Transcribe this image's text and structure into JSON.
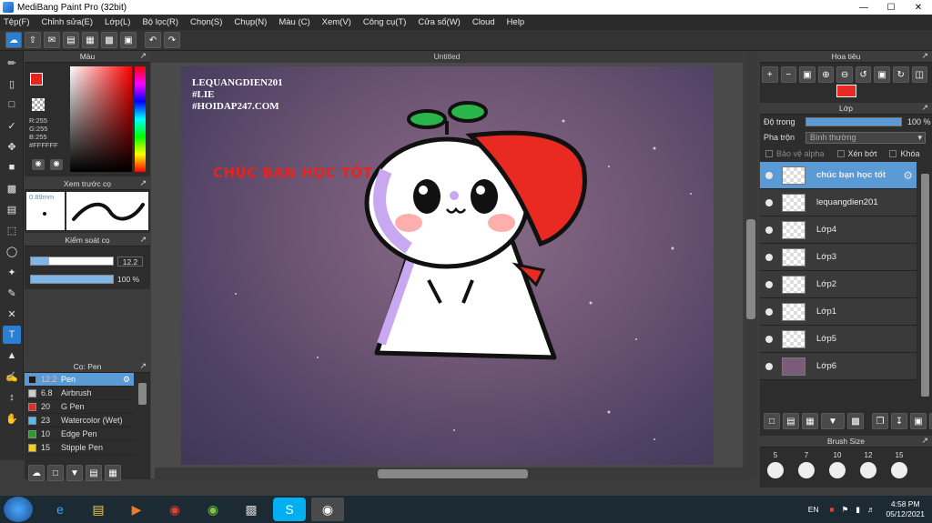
{
  "window": {
    "title": "MediBang Paint Pro (32bit)"
  },
  "menu": [
    "Tệp(F)",
    "Chỉnh sửa(E)",
    "Lớp(L)",
    "Bộ lọc(R)",
    "Chọn(S)",
    "Chụp(N)",
    "Màu (C)",
    "Xem(V)",
    "Công cụ(T)",
    "Cửa sổ(W)",
    "Cloud",
    "Help"
  ],
  "color_panel": {
    "title": "Màu",
    "r": "R:255",
    "g": "G:255",
    "b": "B:255",
    "hex": "#FFFFFF"
  },
  "preview_panel": {
    "title": "Xem trước cọ",
    "size": "0.89mm"
  },
  "brush_control": {
    "title": "Kiểm soát cọ",
    "size": "12.2",
    "opacity": "100 %"
  },
  "brush_panel": {
    "title": "Cọ: Pen",
    "items": [
      {
        "size": "12.2",
        "name": "Pen",
        "color": "#1a1a1a"
      },
      {
        "size": "6.8",
        "name": "Airbrush",
        "color": "#cccccc"
      },
      {
        "size": "20",
        "name": "G Pen",
        "color": "#d93030"
      },
      {
        "size": "23",
        "name": "Watercolor (Wet)",
        "color": "#5ab8ea"
      },
      {
        "size": "10",
        "name": "Edge Pen",
        "color": "#2f9b2f"
      },
      {
        "size": "15",
        "name": "Stipple Pen",
        "color": "#f0d020"
      }
    ]
  },
  "canvas": {
    "title": "Untitled",
    "watermark_lines": [
      "LEQUANGDIEN201",
      "#LIE",
      "#HOIDAP247.COM"
    ],
    "headline": "CHÚC BẠN HỌC TỐT"
  },
  "navigator": {
    "title": "Hoa tiêu"
  },
  "layer_panel": {
    "title": "Lớp",
    "opacity_label": "Độ trong",
    "opacity_value": "100 %",
    "blend_label": "Pha trộn",
    "blend_value": "Bình thường",
    "protect_alpha": "Bảo vệ alpha",
    "clipping": "Xén bớt",
    "lock": "Khóa",
    "layers": [
      "chúc bạn học tốt",
      "lequangdien201",
      "Lớp4",
      "Lớp3",
      "Lớp2",
      "Lớp1",
      "Lớp5",
      "Lớp6"
    ]
  },
  "brush_size_panel": {
    "title": "Brush Size",
    "sizes": [
      "5",
      "7",
      "10",
      "12",
      "15"
    ]
  },
  "taskbar": {
    "lang": "EN",
    "time": "4:58 PM",
    "date": "05/12/2021"
  }
}
